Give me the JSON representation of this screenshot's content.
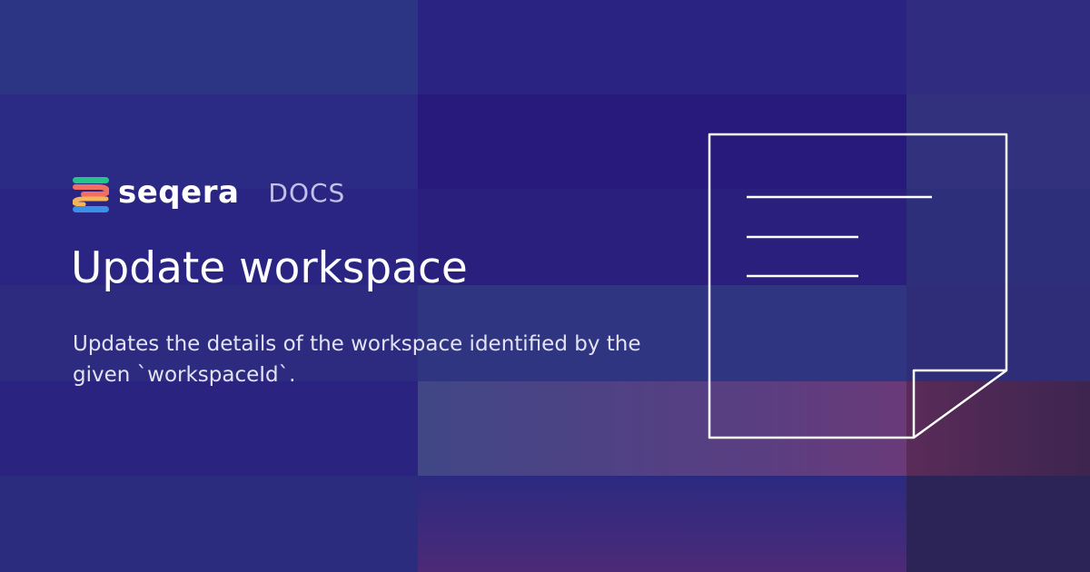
{
  "brand": {
    "name": "seqera",
    "section": "DOCS",
    "logo_icon": "seqera-logo-icon",
    "logo_colors": [
      "#22c48a",
      "#f26e63",
      "#f5b35a",
      "#3c8fe6"
    ]
  },
  "page": {
    "title": "Update workspace",
    "description": "Updates the details of the workspace identified by the given `workspaceId`."
  },
  "illustration": {
    "icon": "document-icon",
    "stroke_color": "#ffffff"
  },
  "colors": {
    "background": "#2a1f7a",
    "text": "#ffffff",
    "muted_text": "#c3c1ea"
  }
}
